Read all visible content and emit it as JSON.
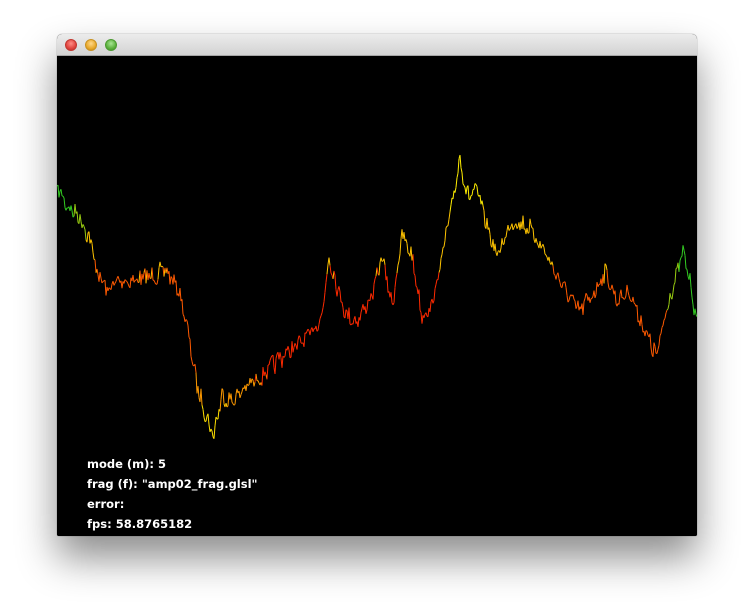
{
  "window": {
    "title": ""
  },
  "hud": {
    "mode_label": "mode (m):",
    "mode_value": "5",
    "frag_label": "frag (f):",
    "frag_value": "\"amp02_frag.glsl\"",
    "error_label": "error:",
    "error_value": "",
    "fps_label": "fps:",
    "fps_value": "58.8765182"
  },
  "colors": {
    "background": "#000000",
    "hud_text": "#ffffff",
    "wave_low": "#ff2a00",
    "wave_mid": "#ffb000",
    "wave_high": "#ffee00",
    "wave_edge": "#33cc22"
  },
  "icons": {
    "close": "close-traffic-light-icon",
    "minimize": "minimize-traffic-light-icon",
    "maximize": "maximize-traffic-light-icon"
  },
  "waveform": {
    "color_mapping": "green at extremes, red at center, yellow at high amplitude"
  }
}
